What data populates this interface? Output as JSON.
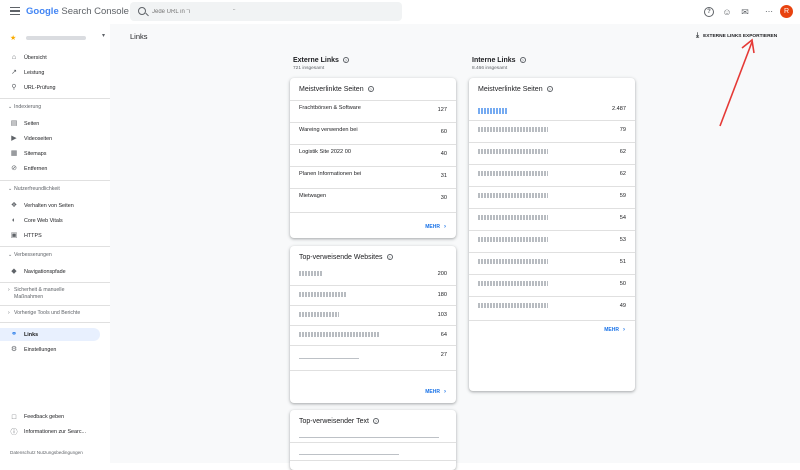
{
  "header": {
    "logo_google": "Google",
    "logo_product": "Search Console",
    "search_placeholder": "Jede URL in \"i                          \"",
    "avatar_letter": "R",
    "icon_names": [
      "menu-icon",
      "search-icon",
      "help-icon",
      "people-icon",
      "bell-icon",
      "apps-icon"
    ]
  },
  "sidebar": {
    "property_name": "",
    "nav_top": [
      {
        "label": "Übersicht",
        "icon": "home-icon"
      },
      {
        "label": "Leistung",
        "icon": "trending-icon"
      },
      {
        "label": "URL-Prüfung",
        "icon": "search-icon"
      }
    ],
    "sections": [
      {
        "title": "Indexierung",
        "items": [
          {
            "label": "Seiten",
            "icon": "pages-icon"
          },
          {
            "label": "Videoseiten",
            "icon": "video-icon"
          },
          {
            "label": "Sitemaps",
            "icon": "sitemap-icon"
          },
          {
            "label": "Entfernen",
            "icon": "remove-icon"
          }
        ]
      },
      {
        "title": "Nutzerfreundlichkeit",
        "items": [
          {
            "label": "Verhalten von Seiten",
            "icon": "page-experience-icon"
          },
          {
            "label": "Core Web Vitals",
            "icon": "speed-icon"
          },
          {
            "label": "HTTPS",
            "icon": "lock-icon"
          }
        ]
      },
      {
        "title": "Verbesserungen",
        "items": [
          {
            "label": "Navigationspfade",
            "icon": "breadcrumb-icon"
          }
        ]
      }
    ],
    "sec_security": "Sicherheit & manuelle",
    "sec_security2": "Maßnahmen",
    "sec_legacy": "Vorherige Tools und Berichte",
    "nav_links": "Links",
    "nav_settings": "Einstellungen",
    "feedback": "Feedback geben",
    "info": "Informationen zur Searc...",
    "footer": "Datenschutz    Nutzungsbedingungen"
  },
  "main": {
    "title": "Links",
    "export_label": "EXTERNE LINKS EXPORTIEREN",
    "external": {
      "heading": "Externe Links",
      "total": "721 insgesamt",
      "cards": {
        "top_pages": {
          "title": "Meistverlinkte Seiten",
          "rows": [
            {
              "label": "Frachtbörsen & Software",
              "value": "127"
            },
            {
              "label": "Wareing verwenden bei",
              "value": "60"
            },
            {
              "label": "Logistik Site 2022 00",
              "value": "40"
            },
            {
              "label": "Planen Informationen bei",
              "value": "31"
            },
            {
              "label": "Mietwagen",
              "value": "30"
            }
          ],
          "more": "MEHR"
        },
        "top_sites": {
          "title": "Top-verweisende Websites",
          "rows": [
            {
              "label": "",
              "value": "200"
            },
            {
              "label": "",
              "value": "180"
            },
            {
              "label": "",
              "value": "103"
            },
            {
              "label": "",
              "value": "64"
            },
            {
              "label": "",
              "value": "27"
            }
          ],
          "more": "MEHR"
        },
        "top_text": {
          "title": "Top-verweisender Text"
        }
      }
    },
    "internal": {
      "heading": "Interne Links",
      "total": "8.466 insgesamt",
      "cards": {
        "top_pages": {
          "title": "Meistverlinkte Seiten",
          "rows": [
            {
              "label": "",
              "value": "2.487"
            },
            {
              "label": "",
              "value": "79"
            },
            {
              "label": "",
              "value": "62"
            },
            {
              "label": "",
              "value": "62"
            },
            {
              "label": "",
              "value": "59"
            },
            {
              "label": "",
              "value": "54"
            },
            {
              "label": "",
              "value": "53"
            },
            {
              "label": "",
              "value": "51"
            },
            {
              "label": "",
              "value": "50"
            },
            {
              "label": "",
              "value": "49"
            }
          ],
          "more": "MEHR"
        }
      }
    }
  },
  "colors": {
    "accent": "#1a73e8",
    "selected_bg": "#e8f0fe",
    "avatar": "#e8430f",
    "annotation": "#e53935"
  }
}
